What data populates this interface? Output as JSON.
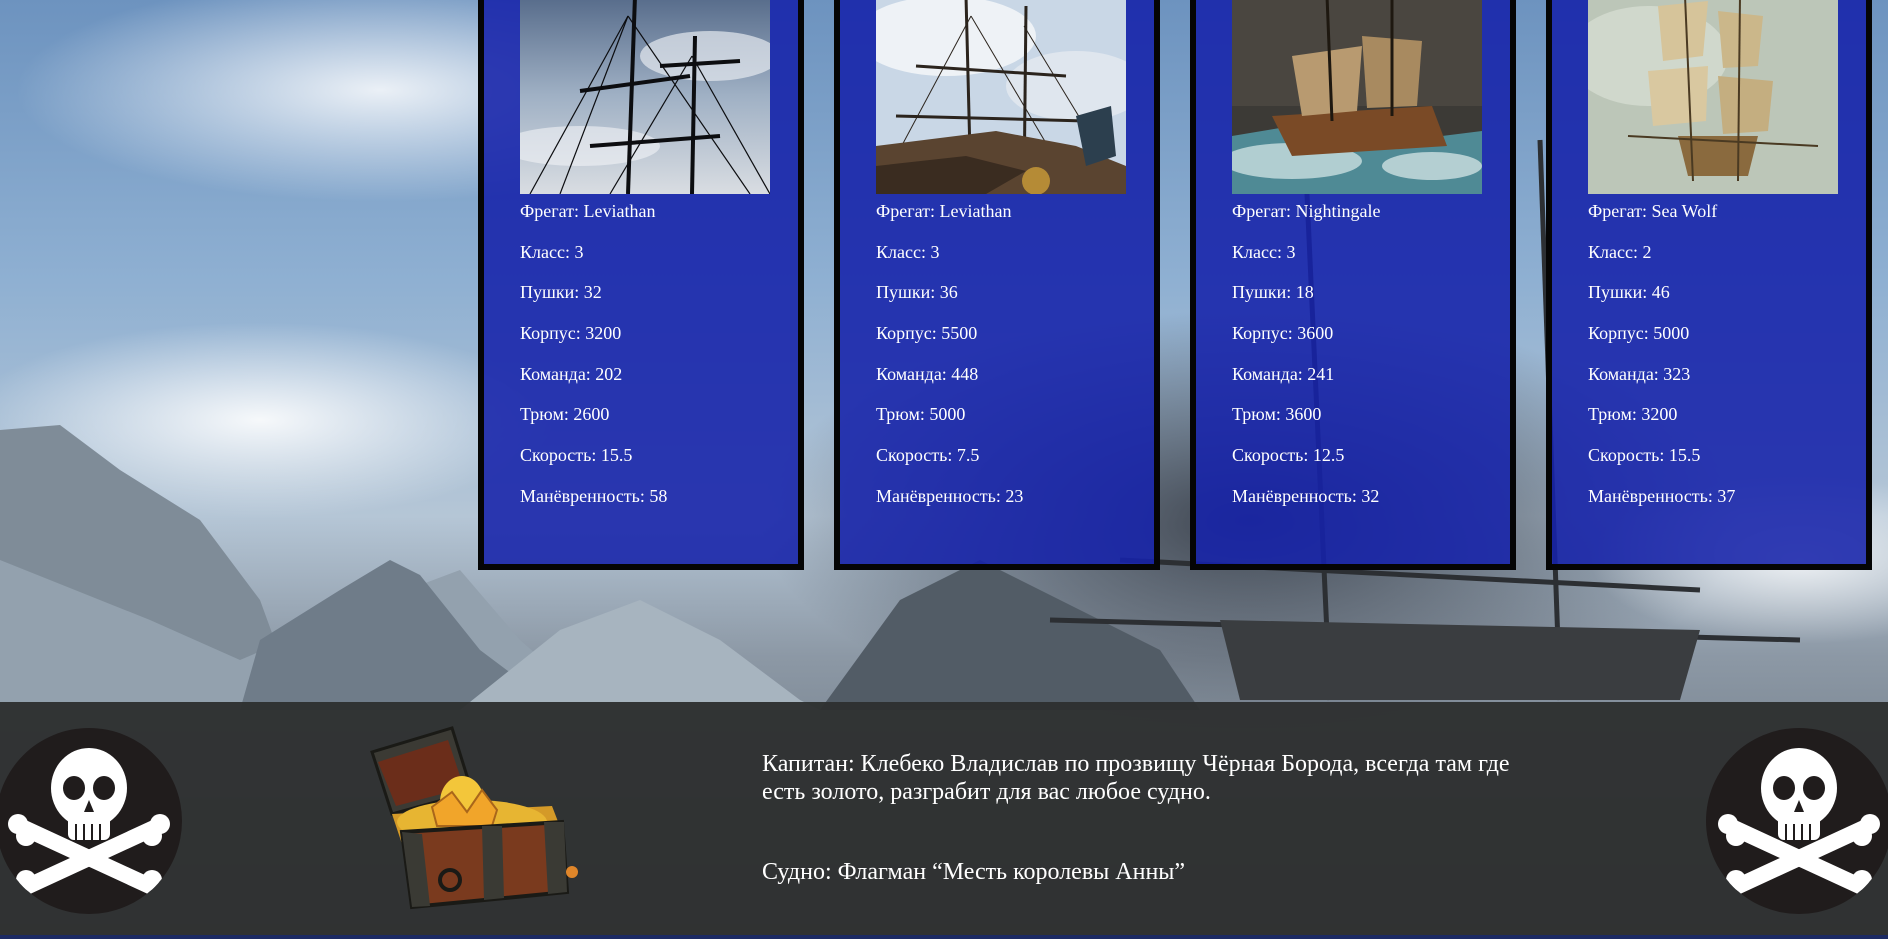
{
  "ships": [
    {
      "image_icon": "ship-mast-photo",
      "stats": [
        {
          "label": "Фрегат: Leviathan"
        },
        {
          "label": "Класс: 3"
        },
        {
          "label": "Пушки: 32"
        },
        {
          "label": "Корпус: 3200"
        },
        {
          "label": "Команда: 202"
        },
        {
          "label": "Трюм: 2600"
        },
        {
          "label": "Скорость: 15.5"
        },
        {
          "label": "Манёвренность: 58"
        }
      ]
    },
    {
      "image_icon": "ship-rigging-photo",
      "stats": [
        {
          "label": "Фрегат: Leviathan"
        },
        {
          "label": "Класс: 3"
        },
        {
          "label": "Пушки: 36"
        },
        {
          "label": "Корпус: 5500"
        },
        {
          "label": "Команда: 448"
        },
        {
          "label": "Трюм: 5000"
        },
        {
          "label": "Скорость: 7.5"
        },
        {
          "label": "Манёвренность: 23"
        }
      ]
    },
    {
      "image_icon": "ship-storm-photo",
      "stats": [
        {
          "label": "Фрегат: Nightingale"
        },
        {
          "label": "Класс: 3"
        },
        {
          "label": "Пушки: 18"
        },
        {
          "label": "Корпус: 3600"
        },
        {
          "label": "Команда: 241"
        },
        {
          "label": "Трюм: 3600"
        },
        {
          "label": "Скорость: 12.5"
        },
        {
          "label": "Манёвренность: 32"
        }
      ]
    },
    {
      "image_icon": "ship-sails-photo",
      "stats": [
        {
          "label": "Фрегат: Sea Wolf"
        },
        {
          "label": "Класс: 2"
        },
        {
          "label": "Пушки: 46"
        },
        {
          "label": "Корпус: 5000"
        },
        {
          "label": "Команда: 323"
        },
        {
          "label": "Трюм: 3200"
        },
        {
          "label": "Скорость: 15.5"
        },
        {
          "label": "Манёвренность: 37"
        }
      ]
    }
  ],
  "footer": {
    "captain": "Капитан: Клебеко Владислав по прозвищу Чёрная Борода, всегда там где есть золото, разграбит для вас любое судно.",
    "ship": "Судно: Флагман “Месть королевы Анны”",
    "left_icon": "skull-crossbones-icon",
    "chest_icon": "treasure-chest-icon",
    "right_icon": "skull-crossbones-icon"
  },
  "colors": {
    "card_bg": "#1622aa",
    "card_border": "#050505",
    "footer_bg": "#2e3030",
    "text": "#ffffff"
  }
}
